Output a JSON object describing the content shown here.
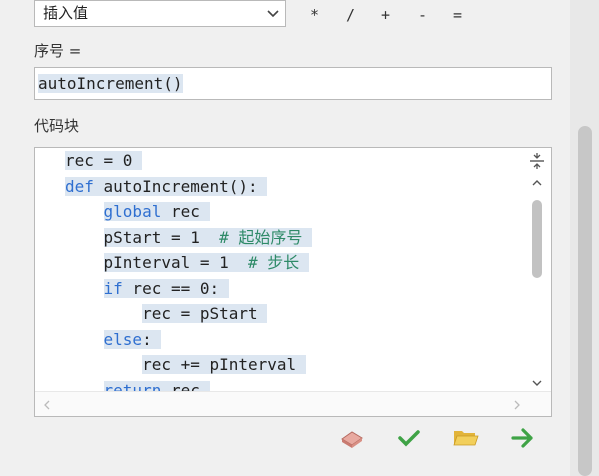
{
  "insert_dropdown": {
    "selected": "插入值"
  },
  "operators": [
    "*",
    "/",
    "+",
    "-",
    "="
  ],
  "sequence_label": "序号 =",
  "expression_value": "autoIncrement()",
  "code_block_label": "代码块",
  "code_lines": [
    {
      "indent": "",
      "parts": [
        [
          "t",
          "rec = 0"
        ]
      ]
    },
    {
      "indent": "",
      "parts": [
        [
          "kw",
          "def"
        ],
        [
          "t",
          " autoIncrement():"
        ]
      ]
    },
    {
      "indent": "    ",
      "parts": [
        [
          "kw",
          "global"
        ],
        [
          "t",
          " rec"
        ]
      ]
    },
    {
      "indent": "    ",
      "parts": [
        [
          "t",
          "pStart = 1  "
        ],
        [
          "cm",
          "# 起始序号"
        ]
      ]
    },
    {
      "indent": "    ",
      "parts": [
        [
          "t",
          "pInterval = 1  "
        ],
        [
          "cm",
          "# 步长"
        ]
      ]
    },
    {
      "indent": "    ",
      "parts": [
        [
          "kw",
          "if"
        ],
        [
          "t",
          " rec == 0:"
        ]
      ]
    },
    {
      "indent": "        ",
      "parts": [
        [
          "t",
          "rec = pStart"
        ]
      ]
    },
    {
      "indent": "    ",
      "parts": [
        [
          "kw",
          "else"
        ],
        [
          "t",
          ":"
        ]
      ]
    },
    {
      "indent": "        ",
      "parts": [
        [
          "t",
          "rec += pInterval"
        ]
      ]
    },
    {
      "indent": "    ",
      "parts": [
        [
          "kw",
          "return"
        ],
        [
          "t",
          " rec"
        ]
      ]
    }
  ],
  "colors": {
    "keyword": "#2f6fd0",
    "comment": "#2e8a68",
    "highlight": "#dce6f1"
  },
  "toolbar_icons": [
    "eraser-icon",
    "checkmark-icon",
    "folder-open-icon",
    "arrow-right-icon"
  ]
}
